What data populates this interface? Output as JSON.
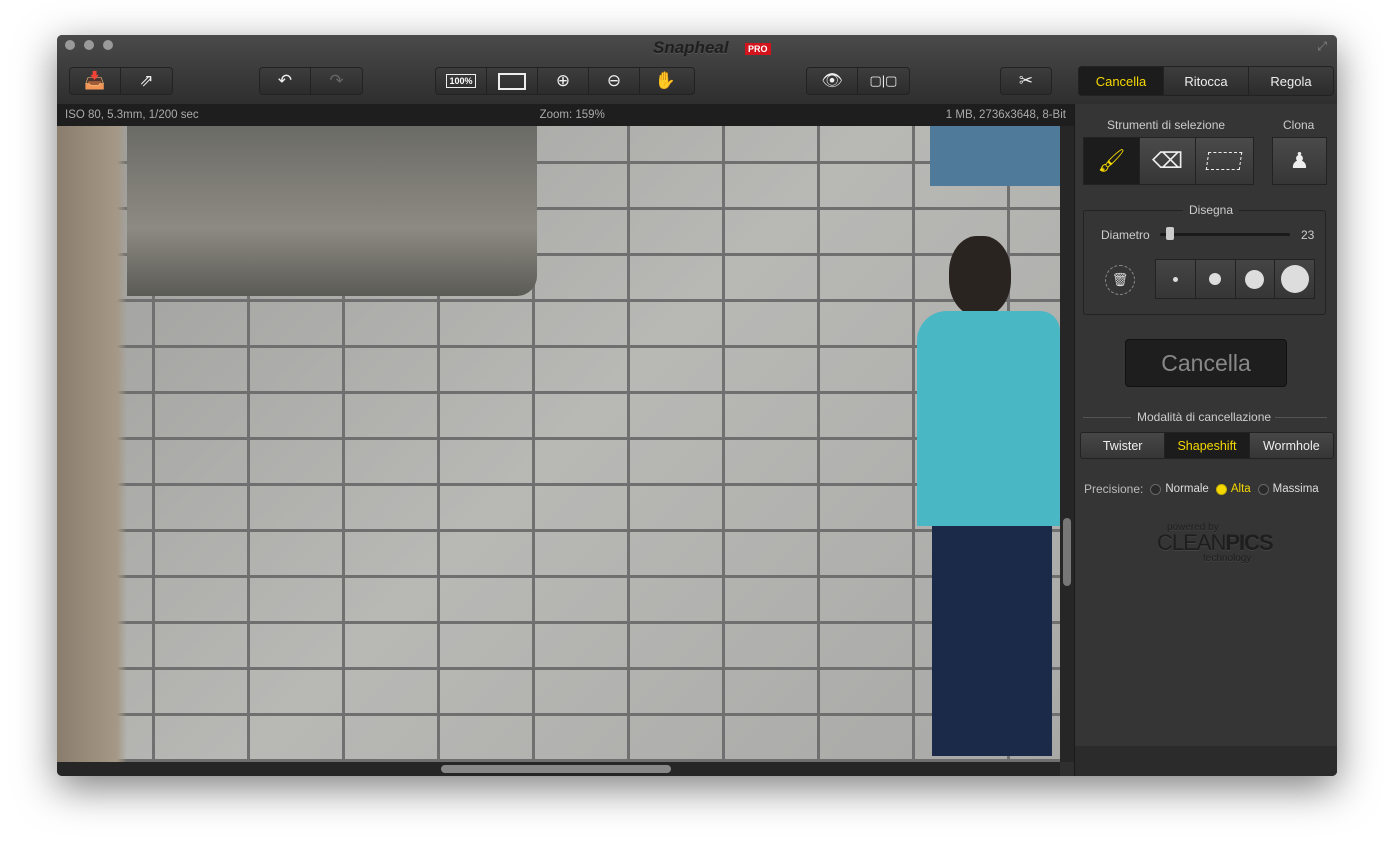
{
  "window": {
    "title": "Snapheal",
    "badge": "PRO"
  },
  "toolbar": {
    "zoom100": "100%"
  },
  "info": {
    "exif": "ISO 80, 5.3mm, 1/200 sec",
    "zoom": "Zoom: 159%",
    "file": "1 MB, 2736x3648, 8-Bit"
  },
  "modes": [
    {
      "label": "Cancella",
      "active": true
    },
    {
      "label": "Ritocca"
    },
    {
      "label": "Regola"
    }
  ],
  "panel": {
    "selection_title": "Strumenti di selezione",
    "clone_title": "Clona",
    "draw_title": "Disegna",
    "diameter_label": "Diametro",
    "diameter_value": "23",
    "diameter_fraction": 0.05,
    "erase_button": "Cancella",
    "erase_mode_title": "Modalità di cancellazione",
    "erase_modes": [
      {
        "label": "Twister"
      },
      {
        "label": "Shapeshift",
        "active": true
      },
      {
        "label": "Wormhole"
      }
    ],
    "precision_label": "Precisione:",
    "precision_options": [
      {
        "label": "Normale"
      },
      {
        "label": "Alta",
        "selected": true
      },
      {
        "label": "Massima"
      }
    ],
    "powered_by": "powered by",
    "brand_a": "CLEAN",
    "brand_b": "PICS",
    "brand_c": "technology",
    "help": "?"
  },
  "colors": {
    "accent": "#f5d800",
    "pro": "#d4141c"
  }
}
